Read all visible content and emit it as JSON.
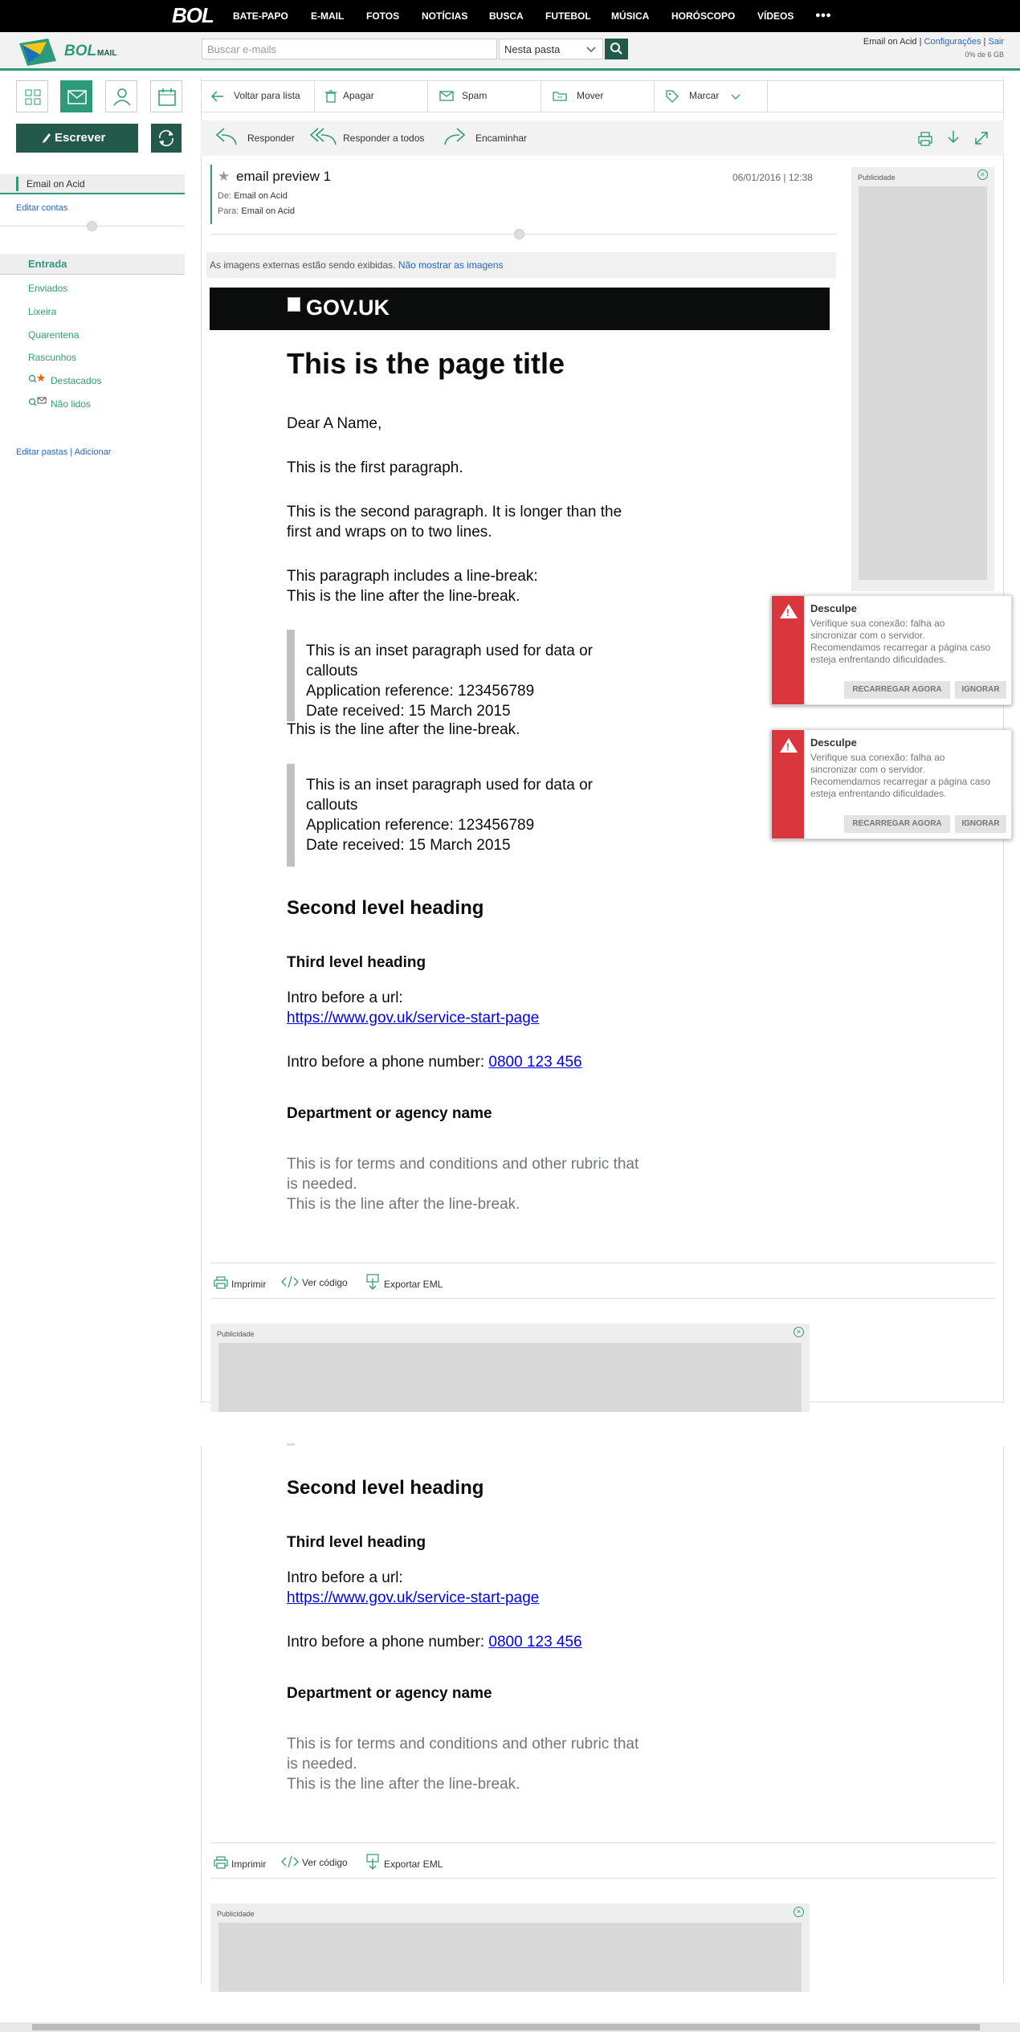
{
  "topnav": {
    "brand": "BOL",
    "items": [
      "BATE-PAPO",
      "E-MAIL",
      "FOTOS",
      "NOTÍCIAS",
      "BUSCA",
      "FUTEBOL",
      "MÚSICA",
      "HORÓSCOPO",
      "VÍDEOS"
    ],
    "more": "●●●"
  },
  "header": {
    "logo_main": "BOL",
    "logo_sub": "MAIL",
    "search_placeholder": "Buscar e-mails",
    "folder_select": "Nesta pasta",
    "user": "Email on Acid",
    "sep1": " | ",
    "settings": "Configurações",
    "sep2": " | ",
    "logout": "Sair",
    "quota": "0% de 6 GB"
  },
  "sidebar": {
    "write": "Escrever",
    "account": "Email on Acid",
    "edit_accounts": "Editar contas",
    "folders": [
      "Enviados",
      "Lixeira",
      "Quarentena",
      "Rascunhos"
    ],
    "inbox": "Entrada",
    "starred": "Destacados",
    "unread": "Não lidos",
    "edit_folders": "Editar pastas",
    "sep": " | ",
    "add": "Adicionar"
  },
  "toolbar": {
    "back": "Voltar para lista",
    "delete": "Apagar",
    "spam": "Spam",
    "move": "Mover",
    "mark": "Marcar",
    "reply": "Responder",
    "reply_all": "Responder a todos",
    "forward": "Encaminhar"
  },
  "message": {
    "subject": "email preview 1",
    "date": "06/01/2016 | 12:38",
    "from_label": "De:",
    "from": "Email on Acid",
    "to_label": "Para:",
    "to": "Email on Acid",
    "images_notice": "As imagens externas estão sendo exibidas.",
    "images_hide": "Não mostrar as imagens"
  },
  "ads": {
    "label": "Publicidade",
    "close": "×"
  },
  "email": {
    "logo": "GOV.UK",
    "title": "This is the page title",
    "greeting": "Dear A Name,",
    "p1": "This is the first paragraph.",
    "p2a": "This is the second paragraph. It is longer than the",
    "p2b": "first and wraps on to two lines.",
    "p3a": "This paragraph includes a line-break:",
    "p3b": "This is the line after the line-break.",
    "inset_a": "This is an inset paragraph used for data or",
    "inset_b": "callouts",
    "inset_c": "Application reference: 123456789",
    "inset_d": "Date received: 15 March 2015",
    "after": "This is the line after the line-break.",
    "h2": "Second level heading",
    "h3": "Third level heading",
    "url_intro": "Intro before a url:",
    "url": "https://www.gov.uk/service-start-page",
    "phone_intro": "Intro before a phone number: ",
    "phone": "0800 123 456",
    "dept": "Department or agency name",
    "terms_a": "This is for terms and conditions and other rubric that",
    "terms_b": "is needed.",
    "terms_c": "This is the line after the line-break."
  },
  "footer": {
    "print": "Imprimir",
    "source": "Ver código",
    "export": "Exportar EML"
  },
  "toast": {
    "title": "Desculpe",
    "line1": "Verifique sua conexão: falha ao",
    "line2": "sincronizar com o servidor.",
    "line3": "Recomendamos recarregar a página caso",
    "line4": "esteja enfrentando dificuldades.",
    "reload": "RECARREGAR AGORA",
    "ignore": "IGNORAR"
  },
  "colors": {
    "accent": "#2e9a7a",
    "dark_green": "#23594a",
    "error": "#d9363e",
    "link": "#2566c4"
  }
}
